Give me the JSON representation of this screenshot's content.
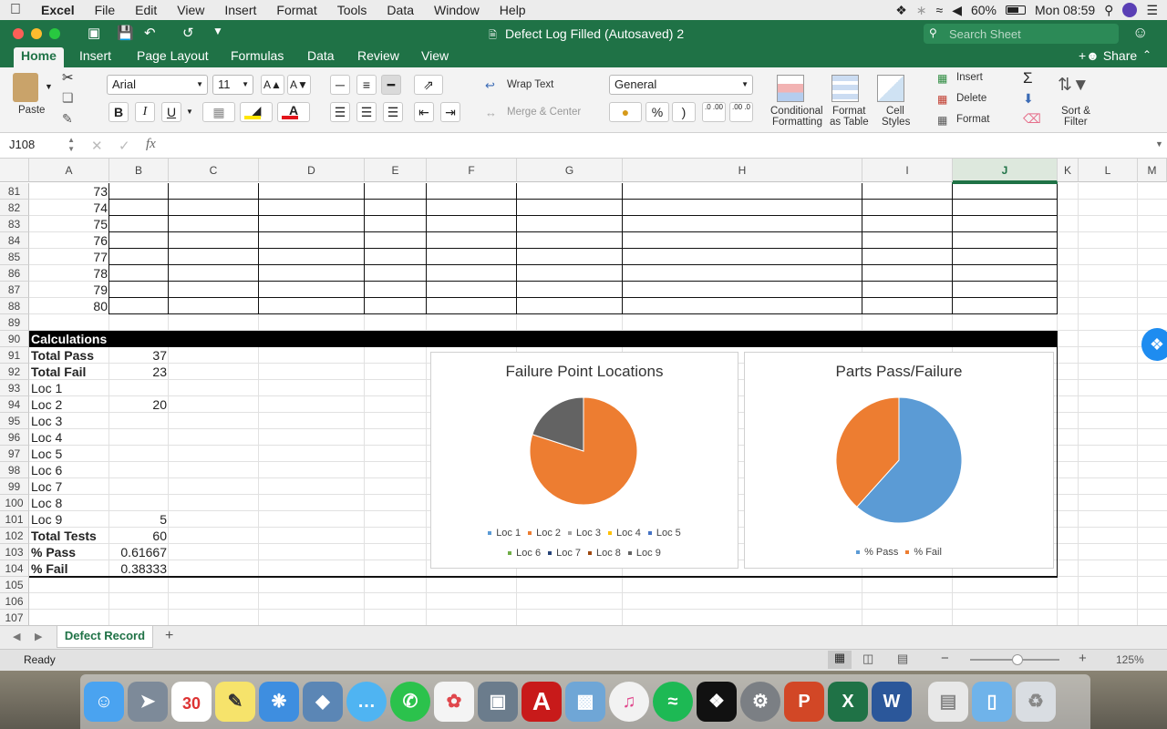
{
  "menubar": {
    "app": "Excel",
    "items": [
      "File",
      "Edit",
      "View",
      "Insert",
      "Format",
      "Tools",
      "Data",
      "Window",
      "Help"
    ],
    "battery": "60%",
    "clock": "Mon 08:59"
  },
  "window": {
    "title": "Defect Log Filled (Autosaved) 2",
    "search_placeholder": "Search Sheet"
  },
  "tabs": [
    "Home",
    "Insert",
    "Page Layout",
    "Formulas",
    "Data",
    "Review",
    "View"
  ],
  "share_label": "Share",
  "ribbon": {
    "paste": "Paste",
    "font_name": "Arial",
    "font_size": "11",
    "bold": "B",
    "italic": "I",
    "underline": "U",
    "wrap_text": "Wrap Text",
    "merge_center": "Merge & Center",
    "number_format": "General",
    "percent": "%",
    "comma": ")",
    "inc_decimal": ".0 .00",
    "dec_decimal": ".00 .0",
    "cond_format_1": "Conditional",
    "cond_format_2": "Formatting",
    "format_table_1": "Format",
    "format_table_2": "as Table",
    "cell_styles_1": "Cell",
    "cell_styles_2": "Styles",
    "insert": "Insert",
    "delete": "Delete",
    "format": "Format",
    "sort_filter_1": "Sort &",
    "sort_filter_2": "Filter"
  },
  "formula_bar": {
    "name_box": "J108",
    "fx": "fx",
    "value": ""
  },
  "columns": [
    "A",
    "B",
    "C",
    "D",
    "E",
    "F",
    "G",
    "H",
    "I",
    "J",
    "K",
    "L",
    "M"
  ],
  "rows": [
    {
      "n": "81",
      "a": "73",
      "b": ""
    },
    {
      "n": "82",
      "a": "74",
      "b": ""
    },
    {
      "n": "83",
      "a": "75",
      "b": ""
    },
    {
      "n": "84",
      "a": "76",
      "b": ""
    },
    {
      "n": "85",
      "a": "77",
      "b": ""
    },
    {
      "n": "86",
      "a": "78",
      "b": ""
    },
    {
      "n": "87",
      "a": "79",
      "b": ""
    },
    {
      "n": "88",
      "a": "80",
      "b": ""
    },
    {
      "n": "89",
      "a": "",
      "b": ""
    },
    {
      "n": "90",
      "a": "Calculations",
      "b": ""
    },
    {
      "n": "91",
      "a": "Total Pass",
      "b": "37"
    },
    {
      "n": "92",
      "a": "Total Fail",
      "b": "23"
    },
    {
      "n": "93",
      "a": "Loc 1",
      "b": ""
    },
    {
      "n": "94",
      "a": "Loc 2",
      "b": "20"
    },
    {
      "n": "95",
      "a": "Loc 3",
      "b": ""
    },
    {
      "n": "96",
      "a": "Loc 4",
      "b": ""
    },
    {
      "n": "97",
      "a": "Loc 5",
      "b": ""
    },
    {
      "n": "98",
      "a": "Loc 6",
      "b": ""
    },
    {
      "n": "99",
      "a": "Loc 7",
      "b": ""
    },
    {
      "n": "100",
      "a": "Loc 8",
      "b": ""
    },
    {
      "n": "101",
      "a": "Loc 9",
      "b": "5"
    },
    {
      "n": "102",
      "a": "Total Tests",
      "b": "60"
    },
    {
      "n": "103",
      "a": "% Pass",
      "b": "0.61667"
    },
    {
      "n": "104",
      "a": "% Fail",
      "b": "0.38333"
    },
    {
      "n": "105",
      "a": "",
      "b": ""
    },
    {
      "n": "106",
      "a": "",
      "b": ""
    },
    {
      "n": "107",
      "a": "",
      "b": ""
    }
  ],
  "chart_data": [
    {
      "type": "pie",
      "title": "Failure Point Locations",
      "categories": [
        "Loc 1",
        "Loc 2",
        "Loc 3",
        "Loc 4",
        "Loc 5",
        "Loc 6",
        "Loc 7",
        "Loc 8",
        "Loc 9"
      ],
      "values": [
        0,
        20,
        0,
        0,
        0,
        0,
        0,
        0,
        5
      ],
      "colors": [
        "#5b9bd5",
        "#ed7d31",
        "#a5a5a5",
        "#ffc000",
        "#4472c4",
        "#70ad47",
        "#264478",
        "#9e480e",
        "#636363"
      ],
      "legend": "bottom"
    },
    {
      "type": "pie",
      "title": "Parts Pass/Failure",
      "categories": [
        "% Pass",
        "% Fail"
      ],
      "values": [
        0.61667,
        0.38333
      ],
      "colors": [
        "#5b9bd5",
        "#ed7d31"
      ],
      "legend": "bottom"
    }
  ],
  "sheet_tab": "Defect Record",
  "add_sheet": "+",
  "status": {
    "ready": "Ready",
    "zoom": "125%"
  }
}
